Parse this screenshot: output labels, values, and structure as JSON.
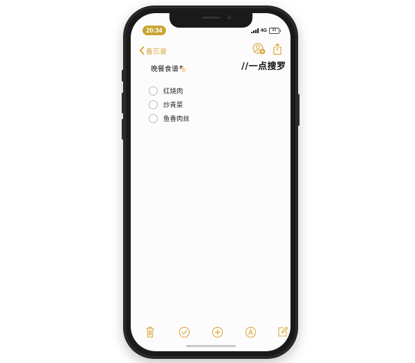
{
  "status_bar": {
    "time": "20:34",
    "network": "4G",
    "battery": "83"
  },
  "nav": {
    "back_label": "备忘录",
    "icons": [
      "back-chevron-icon",
      "collaborator-add-icon",
      "share-icon"
    ]
  },
  "watermark": "//一点搜罗",
  "note": {
    "title": "晚餐食谱",
    "title_emoji": "🍢",
    "checklist": [
      {
        "label": "红烧肉",
        "checked": false
      },
      {
        "label": "炒青菜",
        "checked": false
      },
      {
        "label": "鱼香肉丝",
        "checked": false
      }
    ]
  },
  "toolbar": {
    "icons": [
      "trash-icon",
      "checklist-icon",
      "add-icon",
      "markup-icon",
      "compose-icon"
    ]
  },
  "colors": {
    "accent": "#d9a83b",
    "time_pill": "#c9a634",
    "phone_body": "#2b2b2c",
    "screen_bg": "#fdfcfd"
  }
}
